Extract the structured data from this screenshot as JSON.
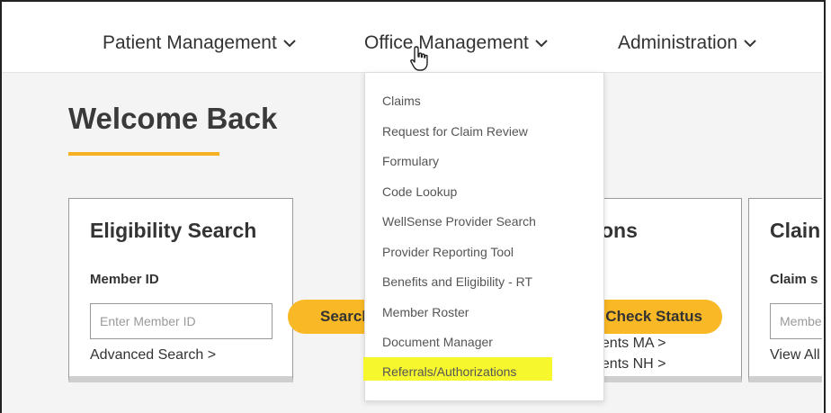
{
  "nav": {
    "items": [
      {
        "label": "Patient Management"
      },
      {
        "label": "Office Management"
      },
      {
        "label": "Administration"
      }
    ]
  },
  "welcome": {
    "title": "Welcome Back"
  },
  "eligibility": {
    "title": "Eligibility Search",
    "member_label": "Member ID",
    "member_placeholder": "Enter Member ID",
    "search_button": "Search",
    "advanced_link": "Advanced Search >"
  },
  "middle_card": {
    "title_fragment": "ons",
    "check_button": "Check Status",
    "link_ma": "nents MA >",
    "link_nh": "nents NH >"
  },
  "claims_card": {
    "title_fragment": "Clain",
    "label_fragment": "Claim s",
    "placeholder_fragment": "Membe",
    "link_fragment": "View All"
  },
  "dropdown": {
    "items": [
      {
        "label": "Claims"
      },
      {
        "label": "Request for Claim Review"
      },
      {
        "label": "Formulary"
      },
      {
        "label": "Code Lookup"
      },
      {
        "label": "WellSense Provider Search"
      },
      {
        "label": "Provider Reporting Tool"
      },
      {
        "label": "Benefits and Eligibility - RT"
      },
      {
        "label": "Member Roster"
      },
      {
        "label": "Document Manager"
      },
      {
        "label": "Referrals/Authorizations"
      }
    ]
  },
  "colors": {
    "accent": "#f9b826",
    "highlight": "#f7f72e",
    "underline": "#f5b024"
  }
}
